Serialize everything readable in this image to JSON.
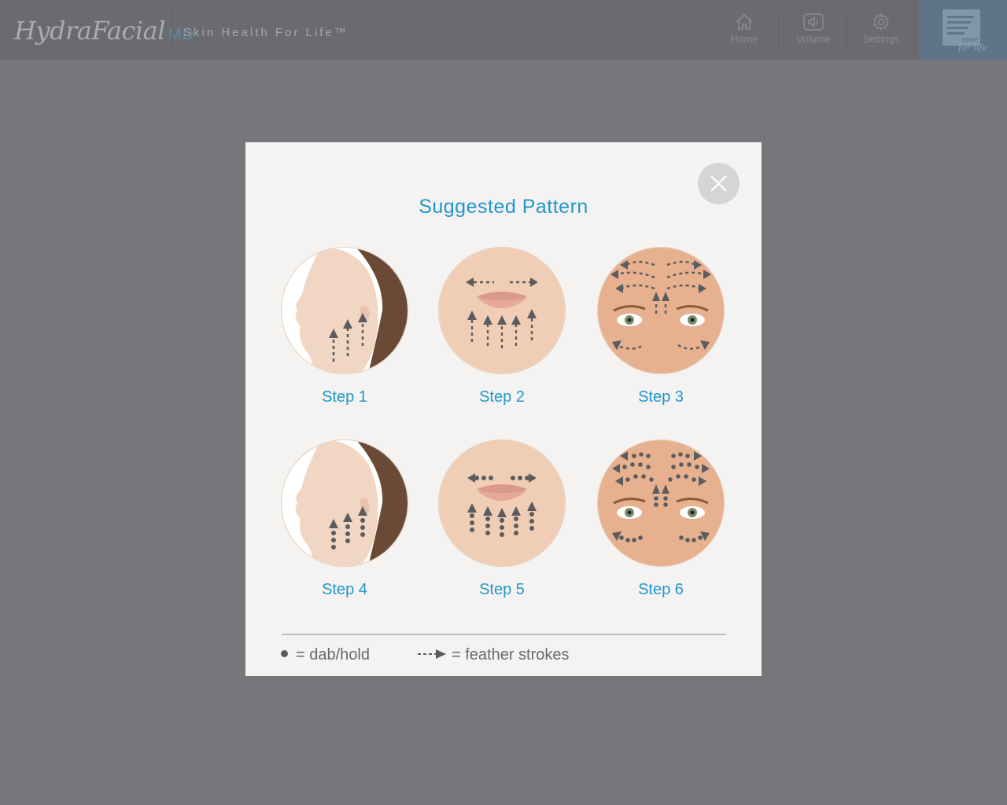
{
  "header": {
    "brand": "HydraFacial",
    "brand_suffix": "MD",
    "tagline": "Skin Health For Life™",
    "nav": [
      {
        "label": "Home",
        "icon": "home-icon"
      },
      {
        "label": "Volume",
        "icon": "speaker-icon"
      },
      {
        "label": "Settings",
        "icon": "gear-icon"
      }
    ],
    "edge_logo_text": "EDGE",
    "edge_script": "for life"
  },
  "modal": {
    "title": "Suggested Pattern",
    "close_icon": "close-icon",
    "steps": [
      {
        "label": "Step 1"
      },
      {
        "label": "Step 2"
      },
      {
        "label": "Step 3"
      },
      {
        "label": "Step 4"
      },
      {
        "label": "Step 5"
      },
      {
        "label": "Step 6"
      }
    ],
    "legend": {
      "dab": "= dab/hold",
      "feather": "= feather strokes"
    }
  },
  "colors": {
    "accent": "#1f97cc",
    "backdrop": "#76777b",
    "header": "#6a6b6f",
    "modal_bg": "#f5f3f2",
    "marker": "#5a5c5f"
  }
}
